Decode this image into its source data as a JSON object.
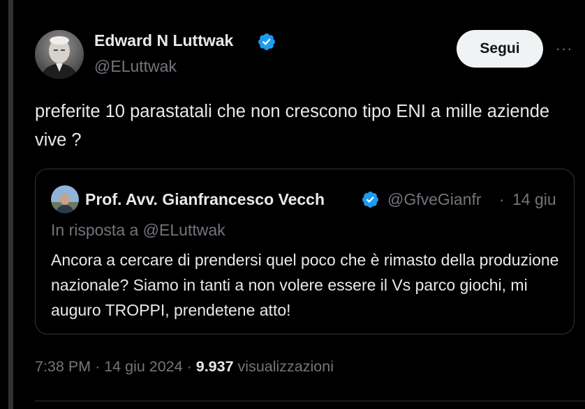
{
  "author": {
    "name": "Edward N Luttwak",
    "handle": "@ELuttwak",
    "verified_badge_icon": "verified-check-icon",
    "verified_color": "#1d9bf0"
  },
  "actions": {
    "follow_label": "Segui",
    "more_icon": "more-horizontal-icon",
    "more_label": "···"
  },
  "tweet": {
    "text": "preferite 10 parastatali che non crescono tipo ENI a mille aziende vive ?"
  },
  "quoted": {
    "name": "Prof. Avv. Gianfrancesco Vecch",
    "handle": "@GfveGianfr",
    "separator": "·",
    "date": "14 giu",
    "reply_to": "In risposta a @ELuttwak",
    "text": "Ancora a cercare di prendersi quel poco che è rimasto della produzione nazionale? Siamo in tanti a non volere essere il Vs parco giochi, mi auguro TROPPI, prendetene atto!"
  },
  "meta": {
    "time": "7:38 PM",
    "sep1": "·",
    "date": "14 giu 2024",
    "sep2": "·",
    "views_count": "9.937",
    "views_label": "visualizzazioni"
  },
  "colors": {
    "background": "#000000",
    "text_primary": "#e7e9ea",
    "text_secondary": "#71767b",
    "border": "#2f3336",
    "button_bg": "#eff3f4"
  }
}
